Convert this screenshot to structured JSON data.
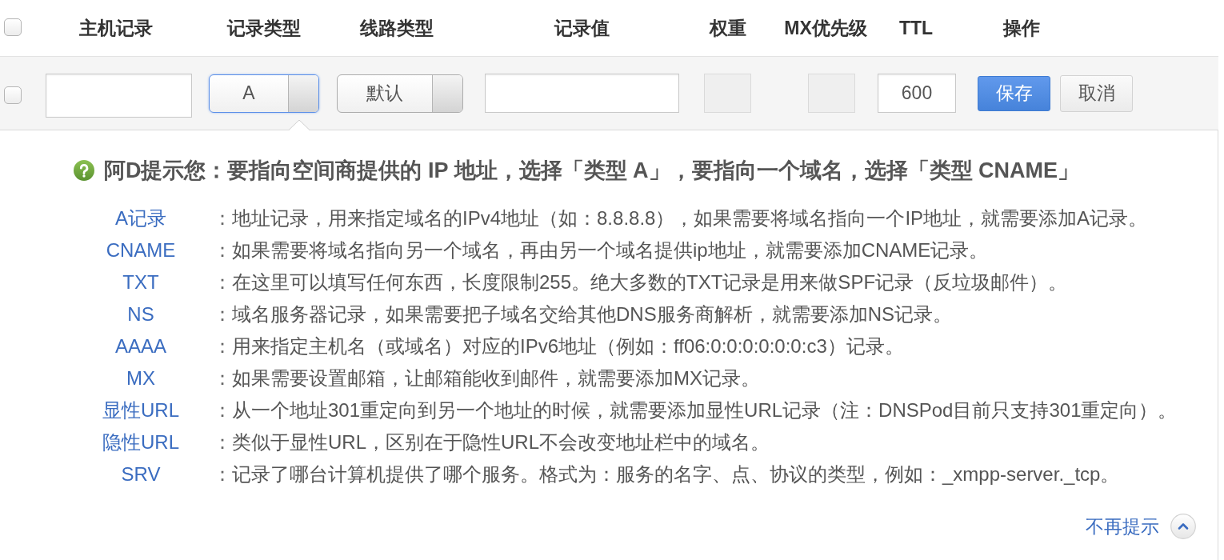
{
  "table_header": {
    "select_all": {
      "checked": false
    },
    "columns": [
      "主机记录",
      "记录类型",
      "线路类型",
      "记录值",
      "权重",
      "MX优先级",
      "TTL",
      "操作"
    ]
  },
  "edit_row": {
    "checked": false,
    "fields": [
      {
        "kind": "input",
        "disabled": false
      },
      {
        "kind": "select",
        "value": "A",
        "focused": true
      },
      {
        "kind": "select",
        "value": "默认",
        "focused": false
      },
      {
        "kind": "input",
        "disabled": false
      },
      {
        "kind": "input",
        "disabled": true
      },
      {
        "kind": "input",
        "disabled": true
      },
      {
        "kind": "input",
        "disabled": false,
        "value": "600"
      }
    ],
    "buttons": [
      {
        "label": "保存",
        "kind": "primary"
      },
      {
        "label": "取消",
        "kind": "default"
      }
    ]
  },
  "hint": {
    "title": "阿D提示您：要指向空间商提供的 IP 地址，选择「类型 A」，要指向一个域名，选择「类型 CNAME」",
    "records": [
      {
        "type": "A记录",
        "separator": "：",
        "description": "地址记录，用来指定域名的IPv4地址（如：8.8.8.8），如果需要将域名指向一个IP地址，就需要添加A记录。"
      },
      {
        "type": "CNAME",
        "separator": "：",
        "description": "如果需要将域名指向另一个域名，再由另一个域名提供ip地址，就需要添加CNAME记录。"
      },
      {
        "type": "TXT",
        "separator": "：",
        "description": "在这里可以填写任何东西，长度限制255。绝大多数的TXT记录是用来做SPF记录（反垃圾邮件）。"
      },
      {
        "type": "NS",
        "separator": "：",
        "description": "域名服务器记录，如果需要把子域名交给其他DNS服务商解析，就需要添加NS记录。"
      },
      {
        "type": "AAAA",
        "separator": "：",
        "description": "用来指定主机名（或域名）对应的IPv6地址（例如：ff06:0:0:0:0:0:0:c3）记录。"
      },
      {
        "type": "MX",
        "separator": "：",
        "description": "如果需要设置邮箱，让邮箱能收到邮件，就需要添加MX记录。"
      },
      {
        "type": "显性URL",
        "separator": "：",
        "description": "从一个地址301重定向到另一个地址的时候，就需要添加显性URL记录（注：DNSPod目前只支持301重定向）。"
      },
      {
        "type": "隐性URL",
        "separator": "：",
        "description": "类似于显性URL，区别在于隐性URL不会改变地址栏中的域名。"
      },
      {
        "type": "SRV",
        "separator": "：",
        "description": "记录了哪台计算机提供了哪个服务。格式为：服务的名字、点、协议的类型，例如：_xmpp-server._tcp。"
      }
    ],
    "dismiss_link": "不再提示"
  }
}
